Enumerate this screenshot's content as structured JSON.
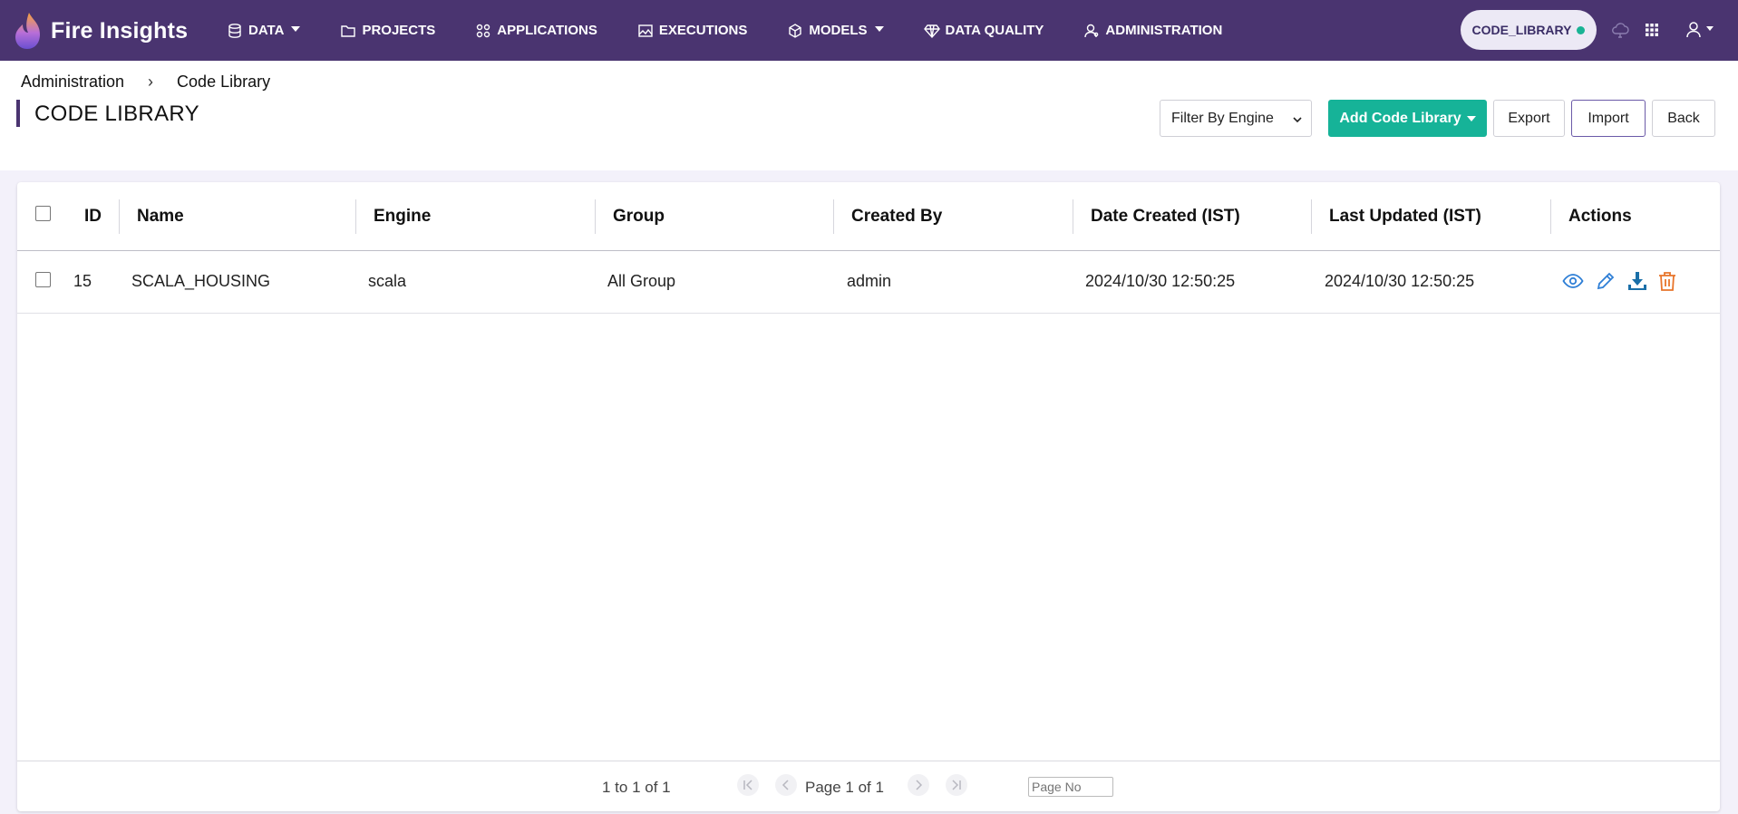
{
  "app": {
    "name": "Fire Insights"
  },
  "nav": {
    "items": [
      {
        "label": "DATA",
        "icon": "database-icon",
        "dropdown": true
      },
      {
        "label": "PROJECTS",
        "icon": "folder-icon",
        "dropdown": false
      },
      {
        "label": "APPLICATIONS",
        "icon": "apps-grid-icon",
        "dropdown": false
      },
      {
        "label": "EXECUTIONS",
        "icon": "chart-image-icon",
        "dropdown": false
      },
      {
        "label": "MODELS",
        "icon": "cube-icon",
        "dropdown": true
      },
      {
        "label": "DATA QUALITY",
        "icon": "diamond-icon",
        "dropdown": false
      },
      {
        "label": "ADMINISTRATION",
        "icon": "user-admin-icon",
        "dropdown": false
      }
    ],
    "context_pill": "CODE_LIBRARY"
  },
  "breadcrumb": {
    "parent": "Administration",
    "current": "Code Library"
  },
  "page": {
    "title": "CODE LIBRARY"
  },
  "toolbar": {
    "filter_label": "Filter By Engine",
    "add_label": "Add Code Library",
    "export_label": "Export",
    "import_label": "Import",
    "back_label": "Back"
  },
  "table": {
    "columns": [
      "ID",
      "Name",
      "Engine",
      "Group",
      "Created By",
      "Date Created (IST)",
      "Last Updated (IST)",
      "Actions"
    ],
    "rows": [
      {
        "id": "15",
        "name": "SCALA_HOUSING",
        "engine": "scala",
        "group": "All Group",
        "created_by": "admin",
        "date_created": "2024/10/30 12:50:25",
        "last_updated": "2024/10/30 12:50:25"
      }
    ]
  },
  "pagination": {
    "summary": "1 to 1 of 1",
    "page_text": "Page 1 of 1",
    "page_input_placeholder": "Page No"
  },
  "colors": {
    "navbar": "#4a3470",
    "accent": "#16b398",
    "view_icon": "#2f7fd6",
    "delete_icon": "#e8742a",
    "download_icon": "#1a6fa8"
  }
}
